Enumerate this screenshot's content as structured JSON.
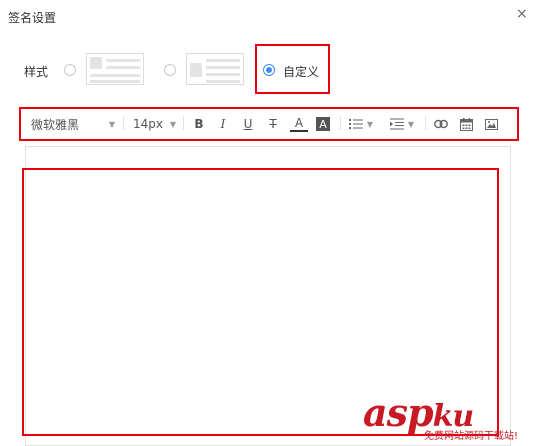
{
  "dialog": {
    "title": "签名设置",
    "close_glyph": "×"
  },
  "style_row": {
    "label": "样式",
    "options": [
      {
        "name": "layout-image-left",
        "selected": false
      },
      {
        "name": "layout-image-right",
        "selected": false
      },
      {
        "name": "custom",
        "label": "自定义",
        "selected": true
      }
    ]
  },
  "toolbar": {
    "font_family": "微软雅黑",
    "font_size": "14px",
    "bold": "B",
    "italic": "I",
    "underline": "U",
    "strike": "T",
    "font_color": "A",
    "bg_color": "A",
    "icons": [
      "list-icon",
      "indent-icon",
      "link-icon",
      "calendar-icon",
      "image-icon"
    ]
  },
  "colors": {
    "accent": "#3f8cf0",
    "highlight_box": "#e60012"
  },
  "watermark": {
    "text": "asp",
    "extra": "ku",
    "sub": "免费网站源码下载站!"
  }
}
